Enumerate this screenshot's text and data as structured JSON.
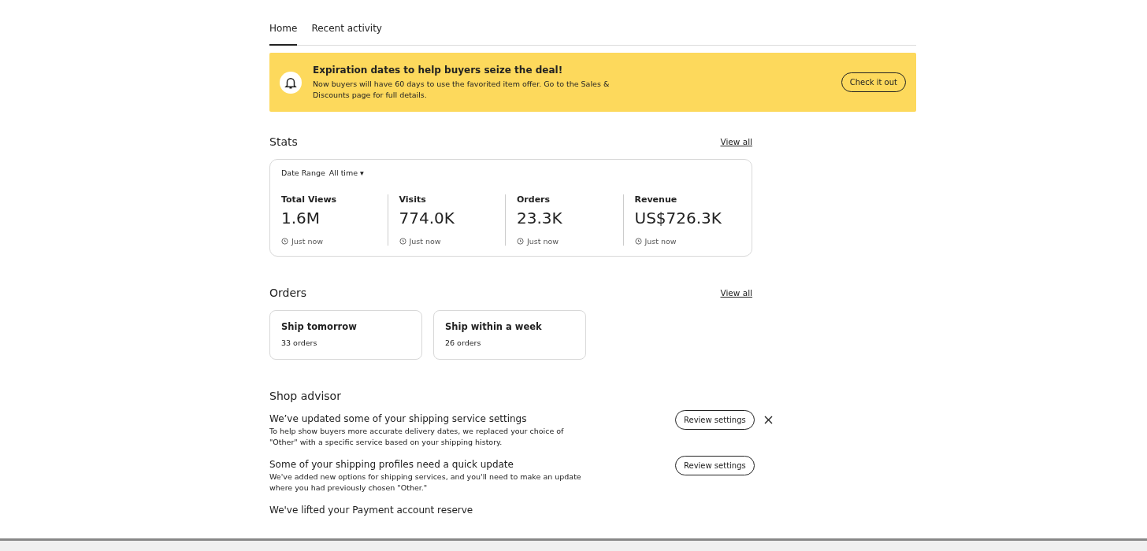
{
  "tabs": [
    {
      "label": "Home",
      "selected": true
    },
    {
      "label": "Recent activity",
      "selected": false
    }
  ],
  "banner": {
    "title": "Expiration dates to help buyers seize the deal!",
    "text": "Now buyers will have 60 days to use the favorited item offer. Go to the Sales & Discounts page for full details.",
    "button": "Check it out"
  },
  "stats": {
    "heading": "Stats",
    "view_all": "View all",
    "date_range_label": "Date Range",
    "date_range_value": "All time",
    "caret": "▾",
    "metrics": [
      {
        "label": "Total Views",
        "value": "1.6M",
        "updated": "Just now"
      },
      {
        "label": "Visits",
        "value": "774.0K",
        "updated": "Just now"
      },
      {
        "label": "Orders",
        "value": "23.3K",
        "updated": "Just now"
      },
      {
        "label": "Revenue",
        "value": "US$726.3K",
        "updated": "Just now"
      }
    ]
  },
  "orders": {
    "heading": "Orders",
    "view_all": "View all",
    "cards": [
      {
        "title": "Ship tomorrow",
        "count": "33 orders"
      },
      {
        "title": "Ship within a week",
        "count": "26 orders"
      }
    ]
  },
  "shop_advisor": {
    "heading": "Shop advisor",
    "items": [
      {
        "title": "We’ve updated some of your shipping service settings",
        "text": "To help show buyers more accurate delivery dates, we replaced your choice of \"Other\" with a specific service based on your shipping history.",
        "button": "Review settings",
        "dismissible": true
      },
      {
        "title": "Some of your shipping profiles need a quick update",
        "text": "We've added new options for shipping services, and you'll need to make an update where you had previously chosen \"Other.\"",
        "button": "Review settings",
        "dismissible": false
      },
      {
        "title": "We've lifted your Payment account reserve",
        "dismissible": false
      }
    ]
  }
}
